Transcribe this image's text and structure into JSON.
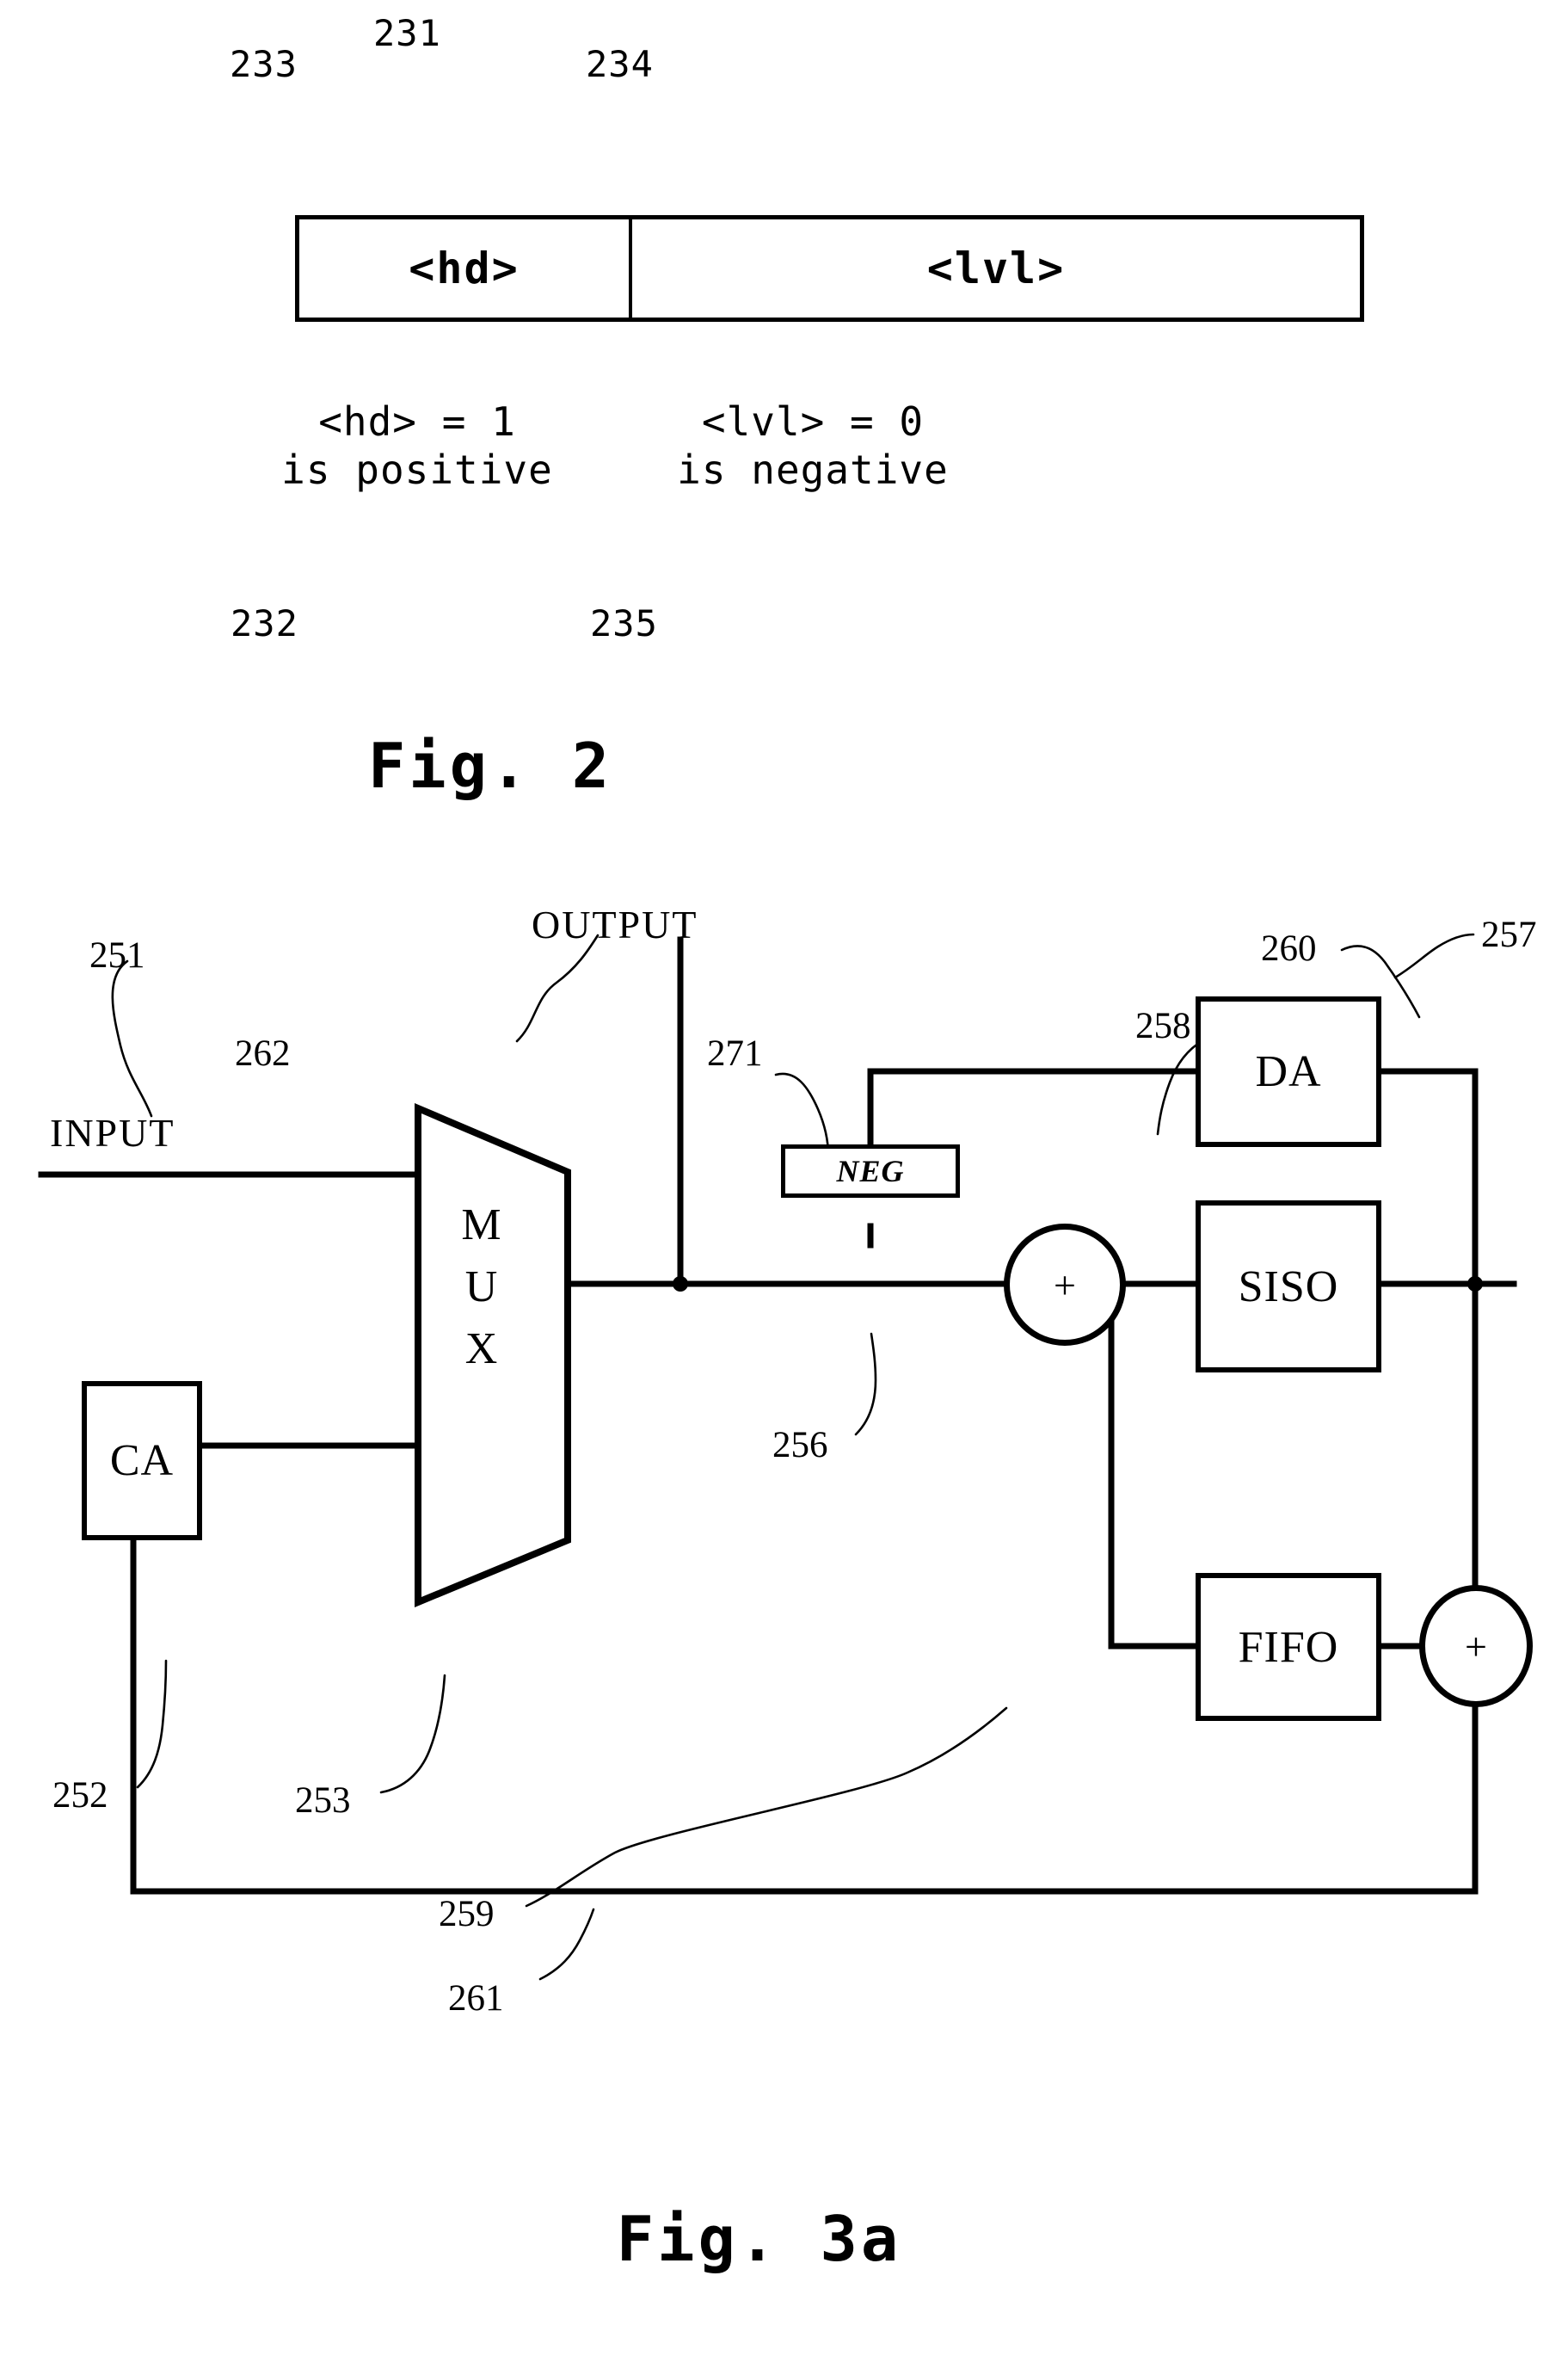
{
  "fig2": {
    "caption": "Fig. 2",
    "ref_231": "231",
    "ref_233": "233",
    "ref_234": "234",
    "ref_232": "232",
    "ref_235": "235",
    "fields": [
      {
        "name": "hd-field",
        "label": "<hd>"
      },
      {
        "name": "lvl-field",
        "label": "<lvl>"
      }
    ],
    "legend_left_line1": "<hd> = 1",
    "legend_left_line2": "is positive",
    "legend_right_line1": "<lvl> = 0",
    "legend_right_line2": "is negative"
  },
  "fig3a": {
    "caption": "Fig. 3a",
    "input_label": "INPUT",
    "output_label": "OUTPUT",
    "blocks": {
      "mux": "MUX",
      "mux_chars": [
        "M",
        "U",
        "X"
      ],
      "ca": "CA",
      "neg": "NEG",
      "da": "DA",
      "siso": "SISO",
      "fifo": "FIFO",
      "adder_256": "+",
      "adder_260": "+"
    },
    "refs": {
      "r251": "251",
      "r252": "252",
      "r253": "253",
      "r256": "256",
      "r257": "257",
      "r258": "258",
      "r259": "259",
      "r260": "260",
      "r261": "261",
      "r262": "262",
      "r271": "271"
    }
  },
  "colors": {
    "ink": "#000000",
    "paper": "#ffffff"
  }
}
